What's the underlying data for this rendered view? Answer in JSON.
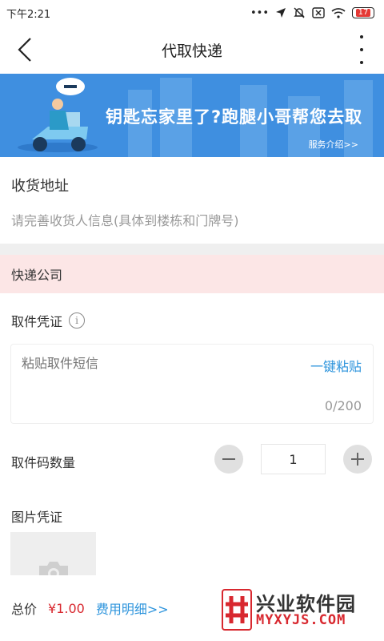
{
  "status_bar": {
    "time": "下午2:21",
    "battery": "17"
  },
  "nav": {
    "title": "代取快递"
  },
  "banner": {
    "headline": "钥匙忘家里了?跑腿小哥帮您去取",
    "link": "服务介绍>>"
  },
  "address": {
    "title": "收货地址",
    "hint": "请完善收货人信息(具体到楼栋和门牌号)"
  },
  "courier": {
    "label": "快递公司"
  },
  "credential": {
    "title": "取件凭证",
    "info_glyph": "i",
    "placeholder": "粘贴取件短信",
    "paste_label": "一键粘贴",
    "char_count": "0/200"
  },
  "quantity": {
    "label": "取件码数量",
    "value": "1"
  },
  "photo": {
    "label": "图片凭证"
  },
  "bottom": {
    "total_label": "总价",
    "total_price": "¥1.00",
    "fee_link": "费用明细>>"
  },
  "watermark": {
    "cn": "兴业软件园",
    "en": "MYXYJS.COM"
  },
  "colors": {
    "banner": "#3f8fe0",
    "accent": "#2d94dc",
    "price": "#d8282f",
    "highlight_row": "#fce6e6"
  }
}
